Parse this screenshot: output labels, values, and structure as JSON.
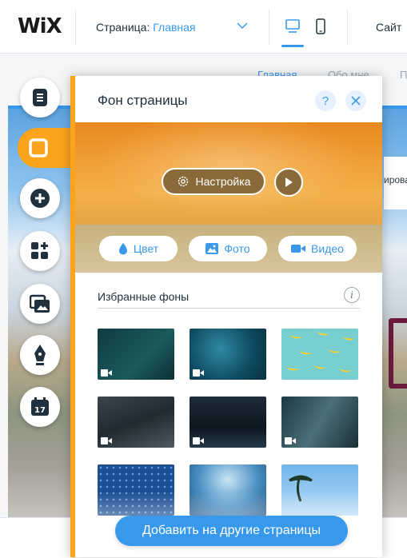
{
  "topbar": {
    "logo": "WiX",
    "page_label": "Страница:",
    "page_value": "Главная",
    "site_label": "Сайт"
  },
  "site": {
    "nav": [
      "Главная",
      "Обо мне",
      "П"
    ],
    "side_text": "ировани"
  },
  "left_toolbar": {
    "items": [
      {
        "name": "pages-icon",
        "active": false
      },
      {
        "name": "background-icon",
        "active": true
      },
      {
        "name": "add-icon",
        "active": false
      },
      {
        "name": "apps-icon",
        "active": false
      },
      {
        "name": "media-icon",
        "active": false
      },
      {
        "name": "blog-pen-icon",
        "active": false
      },
      {
        "name": "bookings-calendar-icon",
        "active": false,
        "text": "17"
      }
    ]
  },
  "panel": {
    "title": "Фон страницы",
    "help": "?",
    "customize_label": "Настройка",
    "types": [
      {
        "label": "Цвет",
        "icon": "drop-icon"
      },
      {
        "label": "Фото",
        "icon": "image-icon"
      },
      {
        "label": "Видео",
        "icon": "video-camera-icon"
      }
    ],
    "favorites_title": "Избранные фоны",
    "info": "i",
    "apply_all_label": "Добавить на другие страницы"
  },
  "colors": {
    "accent": "#3899ec",
    "panel_accent": "#fba31a"
  }
}
